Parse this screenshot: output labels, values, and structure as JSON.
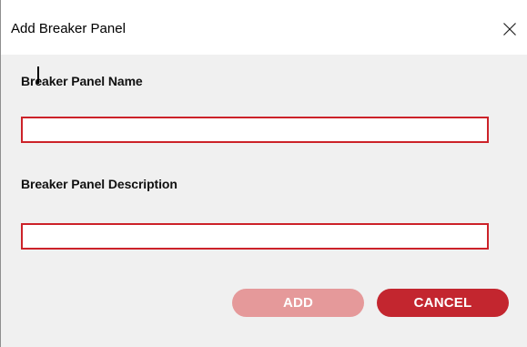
{
  "dialog": {
    "title": "Add Breaker Panel",
    "close_icon": "close-icon"
  },
  "form": {
    "name_label": "Breaker Panel Name",
    "name_value": "",
    "description_label": "Breaker Panel Description",
    "description_value": ""
  },
  "buttons": {
    "add_label": "ADD",
    "add_state": "disabled",
    "cancel_label": "CANCEL"
  },
  "colors": {
    "accent": "#c3262f",
    "accent_disabled": "#e5999a",
    "field_border": "#cc2229",
    "content_background": "#f0f0f0"
  }
}
